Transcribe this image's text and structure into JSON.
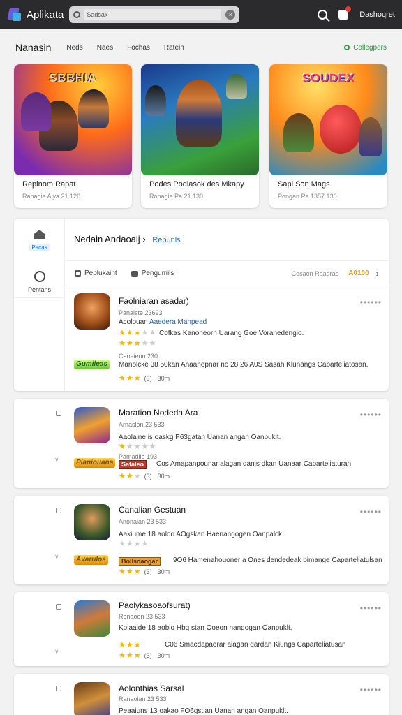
{
  "header": {
    "app_title": "Aplikata",
    "search_value": "Sadsak",
    "user_name": "Dashoqret"
  },
  "nav": {
    "section_title": "Nanasin",
    "tabs": [
      "Neds",
      "Naes",
      "Fochas",
      "Ratein"
    ],
    "collections_label": "Collegpers"
  },
  "featured": [
    {
      "art_title": "SBBHIA",
      "name": "Repinom Rapat",
      "sub": "Rapagie A ya 21 120"
    },
    {
      "art_title": "",
      "name": "Podes Podlasok des Mkapy",
      "sub": "Ronagie Pa 21 130"
    },
    {
      "art_title": "SOUDEX",
      "name": "Sapi Son Mags",
      "sub": "Pongan Pa 1357 130"
    }
  ],
  "sidebar": {
    "home_label": "Pacas",
    "genres_label": "Pentans"
  },
  "list_header": {
    "title": "Nedain Andaoaij",
    "crumb": "Repunls"
  },
  "filters": {
    "f1": "Peplukaint",
    "f2": "Pengumils",
    "sort": "Cosaon Raaoras",
    "ab": "A0100"
  },
  "items": [
    {
      "title": "Faolniaran asadar)",
      "sub1": "Panaiste 23693",
      "line1_a": "Acolouan",
      "line1_b": "Aaedera Manpead",
      "line2": "Cofkas Kanoheorn Uarang Goe Voranedengio.",
      "sub2": "Ceoaieon 230",
      "badge": "Gumileas",
      "line3": "Manolcke 38 50kan Anaanepnar no 28 26 A0S Sasah Klunangs Caparteliatosan.",
      "cnt": "(3)",
      "time": "30m",
      "stars_a": 3,
      "stars_b": 3,
      "stars_c": 3
    },
    {
      "title": "Maration Nodeda Ara",
      "sub1": "Arnaslon 23 533",
      "line1": "Aaolaine is oaskg P63gatan Uanan angan Oanpuklt.",
      "badge": "Planiouans",
      "sub2": "Panadine 193",
      "tag": "Safaleo",
      "line3": "Cos Amapanpounar alagan danis dkan Uanaar Caparteliaturan",
      "cnt": "(3)",
      "time": "30m",
      "stars_a": 1,
      "stars_c": 3
    },
    {
      "title": "Canalian Gestuan",
      "sub1": "Anonaian 23 533",
      "line1": "Aakiume 18 aoloo AOgskan Haenangogen Oanpalck.",
      "badge": "Avarulos",
      "tag": "Bollsoaogar",
      "line3": "9O6 Hamenahouoner a Qnes dendedeak bimange Caparteliatulsan",
      "cnt": "(3)",
      "time": "30m",
      "stars_a": 1,
      "stars_c": 3
    },
    {
      "title": "Paolykasoaofsurat)",
      "sub1": "Ronaoon 23 533",
      "line1": "Koiaaide 18 aobio Hbg stan Ooeon nangogan Oanpuklt.",
      "line3": "C06 Smacdapaorar aiagan dardan Kiungs Caparteliatusan",
      "cnt": "(3)",
      "time": "30m",
      "stars_b": 3,
      "stars_c": 3
    },
    {
      "title": "Aolonthias Sarsal",
      "sub1": "Ranaoian 23 533",
      "line1": "Peaaiuns 13 oakao FO6gstian Uanan angan Oanpuklt.",
      "stars_a": 0
    }
  ],
  "colors": {
    "accent": "#1a73e8",
    "collections_green": "#2e9a3c",
    "star": "#f4b400",
    "topbar": "#2b2b2d"
  }
}
